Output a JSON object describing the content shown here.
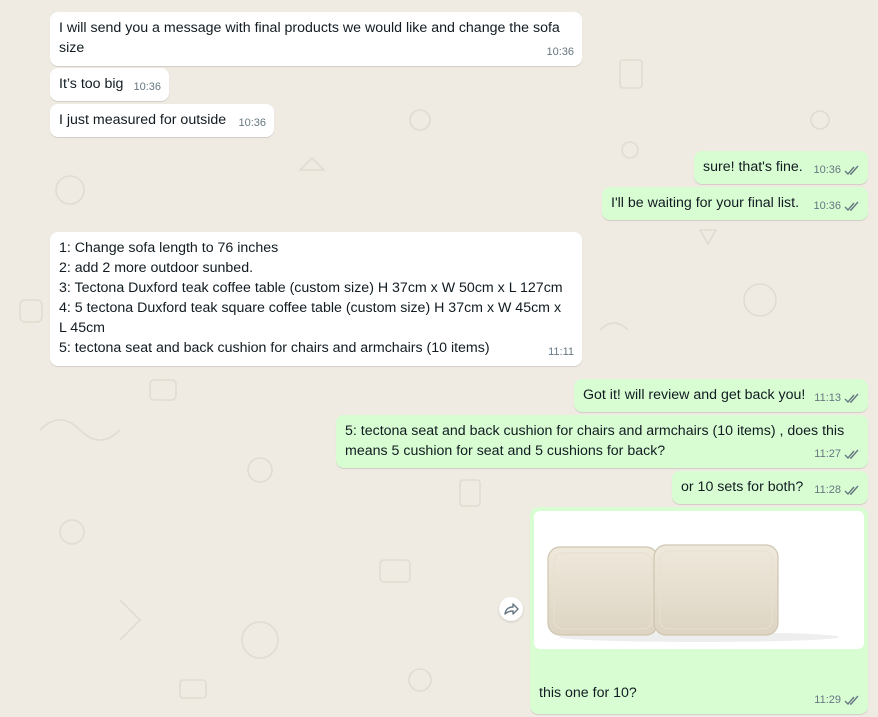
{
  "messages": [
    {
      "id": "m1",
      "dir": "in",
      "lines": "I will send you a message with final products we would like and change the sofa\nsize",
      "time": "10:36"
    },
    {
      "id": "m2",
      "dir": "in",
      "lines": "It’s too big",
      "time": "10:36"
    },
    {
      "id": "m3",
      "dir": "in",
      "lines": "I just measured for outside",
      "time": "10:36"
    },
    {
      "id": "m4",
      "dir": "out",
      "lines": "sure! that's fine.",
      "time": "10:36"
    },
    {
      "id": "m5",
      "dir": "out",
      "lines": "I'll be waiting for your final list.",
      "time": "10:36"
    },
    {
      "id": "m6",
      "dir": "in",
      "lines": "1: Change sofa length to 76 inches\n2: add 2 more outdoor sunbed.\n3: Tectona Duxford teak coffee table (custom size) H 37cm x W 50cm x L 127cm\n4: 5 tectona Duxford teak square coffee table (custom size) H 37cm x W 45cm x\nL 45cm\n5: tectona seat and back cushion for chairs and armchairs (10 items)",
      "time": "11:11"
    },
    {
      "id": "m7",
      "dir": "out",
      "lines": "Got it! will review and get back you!",
      "time": "11:13"
    },
    {
      "id": "m8",
      "dir": "out",
      "lines": "5: tectona seat and back cushion for chairs and armchairs (10 items) , does this\nmeans 5 cushion for seat and 5 cushions for back?",
      "time": "11:27"
    },
    {
      "id": "m9",
      "dir": "out",
      "lines": "or 10 sets for both?",
      "time": "11:28"
    },
    {
      "id": "m10",
      "dir": "out",
      "lines": "this one for 10?",
      "time": "11:29"
    }
  ],
  "icons": {
    "read_ticks": "double-check-icon",
    "forward": "forward-icon",
    "image": "cushion-image"
  },
  "colors": {
    "background": "#efeae2",
    "incoming": "#ffffff",
    "outgoing": "#d9fdd3",
    "tick": "#667781"
  }
}
